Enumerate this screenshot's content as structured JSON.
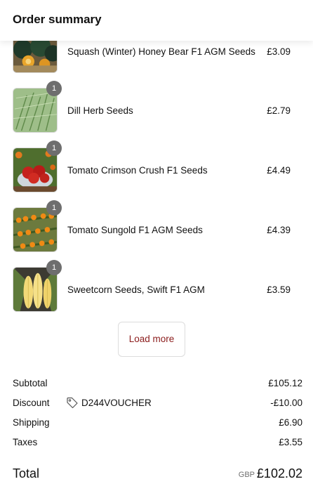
{
  "header": {
    "title": "Order summary"
  },
  "items": [
    {
      "name": "Squash (Winter) Honey Bear F1 AGM Seeds",
      "price": "£3.09",
      "image": "squash-image"
    },
    {
      "name": "Dill Herb Seeds",
      "price": "£2.79",
      "quantity": "1",
      "image": "dill-image"
    },
    {
      "name": "Tomato Crimson Crush F1 Seeds",
      "price": "£4.49",
      "quantity": "1",
      "image": "tomato-red-image"
    },
    {
      "name": "Tomato Sungold F1 AGM Seeds",
      "price": "£4.39",
      "quantity": "1",
      "image": "tomato-orange-image"
    },
    {
      "name": "Sweetcorn Seeds, Swift F1 AGM",
      "price": "£3.59",
      "quantity": "1",
      "image": "sweetcorn-image"
    }
  ],
  "load_more_label": "Load more",
  "summary": {
    "subtotal_label": "Subtotal",
    "subtotal_value": "£105.12",
    "discount_label": "Discount",
    "discount_code": "D244VOUCHER",
    "discount_value": "-£10.00",
    "shipping_label": "Shipping",
    "shipping_value": "£6.90",
    "taxes_label": "Taxes",
    "taxes_value": "£3.55",
    "total_label": "Total",
    "currency": "GBP",
    "total_value": "£102.02"
  },
  "colors": {
    "accent": "#8b1c1c",
    "badge": "#6e6e6e"
  }
}
